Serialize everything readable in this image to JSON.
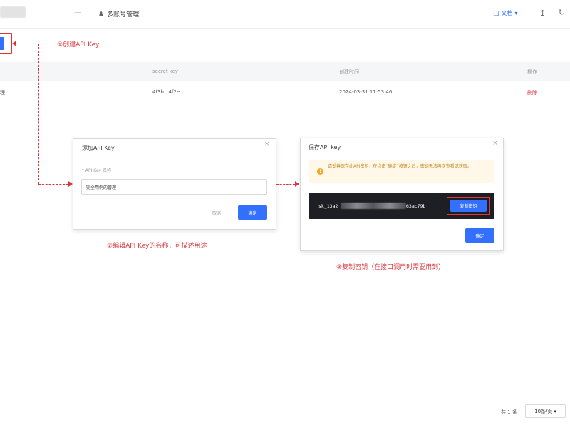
{
  "header": {
    "nav_separator": "—",
    "title": "多账号管理",
    "title_icon": "user-icon",
    "doc_label": "文档",
    "doc_caret": "▾",
    "doc_icon": "document-icon",
    "right_icons": [
      "upload-icon",
      "refresh-icon"
    ]
  },
  "annotations": {
    "step1": "①创建API Key",
    "step2": "②编辑API Key的名称，可描述用途",
    "step3": "③复制密钥（在接口调用时需要用到）",
    "color": "#d9363e"
  },
  "table": {
    "columns": [
      "secret key",
      "创建时间",
      "操作"
    ],
    "rows": [
      {
        "name_fragment": "理",
        "secret_key": "4f3b...4f2e",
        "created_at": "2024-03-31 11:53:46",
        "action": "删除"
      }
    ]
  },
  "add_dialog": {
    "title": "添加API Key",
    "close_glyph": "×",
    "field_label": "* API Key 名称",
    "field_value": "完全用例的管理",
    "cancel_label": "取消",
    "confirm_label": "确定"
  },
  "save_dialog": {
    "title": "保存API key",
    "close_glyph": "×",
    "warning_glyph": "!",
    "warning_text": "请妥善保存此API密钥，在点击“确定”按钮之后，密钥无法再次查看或获取。",
    "key_prefix": "sk_13a2",
    "key_suffix": "63ac79b",
    "copy_label": "复制密钥",
    "confirm_label": "确定"
  },
  "pagination": {
    "total_text": "共 1 条",
    "page_size": "10条/页",
    "caret": "▾"
  },
  "colors": {
    "primary": "#3370ff",
    "annotation": "#d9363e",
    "warning_bg": "#fff7e8",
    "key_bg": "#1d1f25"
  }
}
